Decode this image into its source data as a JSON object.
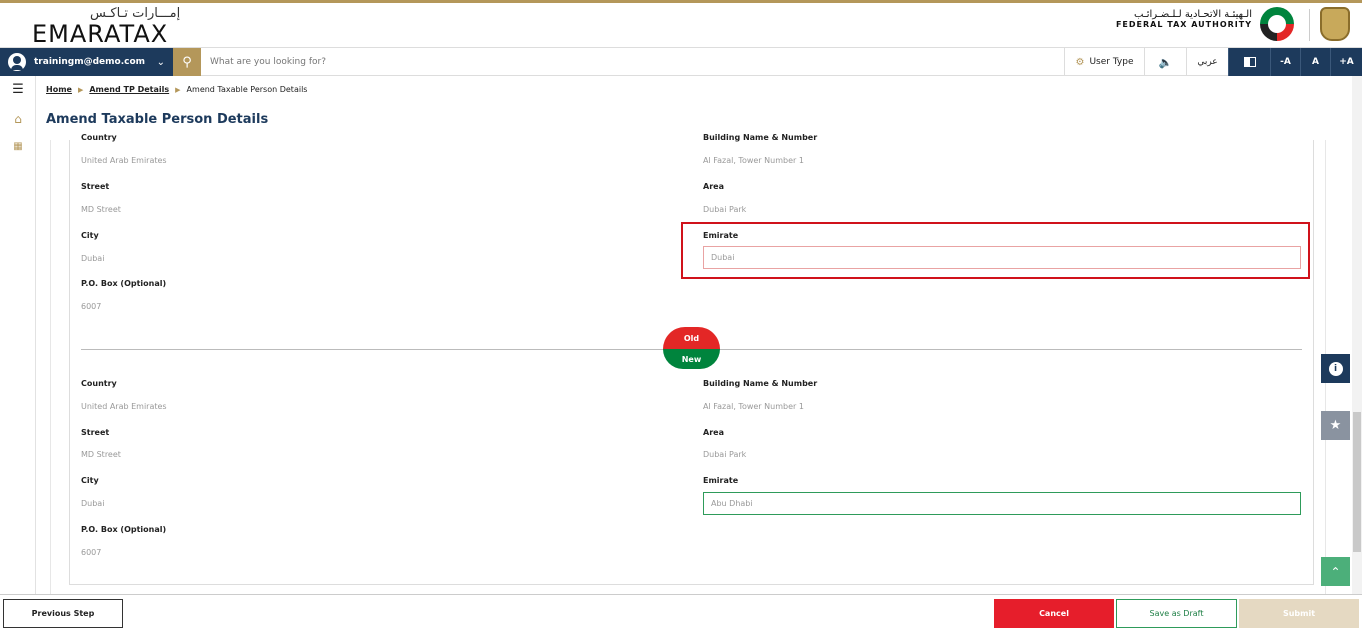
{
  "header": {
    "logo_arabic": "إمـــارات تـاكـس",
    "logo_english": "EMARATAX",
    "authority_arabic": "الـهيئـة الاتحـادية لـلـضـرائـب",
    "authority_english": "FEDERAL TAX AUTHORITY"
  },
  "navbar": {
    "user_email": "trainingm@demo.com",
    "search_placeholder": "What are you looking for?",
    "user_type_label": "User Type",
    "language_label": "عربي",
    "font_decrease": "-A",
    "font_normal": "A",
    "font_increase": "+A"
  },
  "breadcrumb": {
    "home": "Home",
    "amend_tp": "Amend TP Details",
    "current": "Amend Taxable Person Details"
  },
  "page": {
    "title": "Amend Taxable Person Details"
  },
  "old_address": {
    "country_label": "Country",
    "country_value": "United Arab Emirates",
    "building_label": "Building Name & Number",
    "building_value": "Al Fazal, Tower Number 1",
    "street_label": "Street",
    "street_value": "MD Street",
    "area_label": "Area",
    "area_value": "Dubai Park",
    "city_label": "City",
    "city_value": "Dubai",
    "emirate_label": "Emirate",
    "emirate_value": "Dubai",
    "pobox_label": "P.O. Box (Optional)",
    "pobox_value": "6007"
  },
  "comparison": {
    "old_label": "Old",
    "new_label": "New"
  },
  "new_address": {
    "country_label": "Country",
    "country_value": "United Arab Emirates",
    "building_label": "Building Name & Number",
    "building_value": "Al Fazal, Tower Number 1",
    "street_label": "Street",
    "street_value": "MD Street",
    "area_label": "Area",
    "area_value": "Dubai Park",
    "city_label": "City",
    "city_value": "Dubai",
    "emirate_label": "Emirate",
    "emirate_value": "Abu Dhabi",
    "pobox_label": "P.O. Box (Optional)",
    "pobox_value": "6007"
  },
  "footer": {
    "previous_step": "Previous Step",
    "cancel": "Cancel",
    "save_draft": "Save as Draft",
    "submit": "Submit"
  },
  "colors": {
    "primary_navy": "#1d3a5c",
    "gold": "#b4975a",
    "old_red": "#e32726",
    "new_green": "#00843d",
    "highlight_red": "#d0121b"
  }
}
